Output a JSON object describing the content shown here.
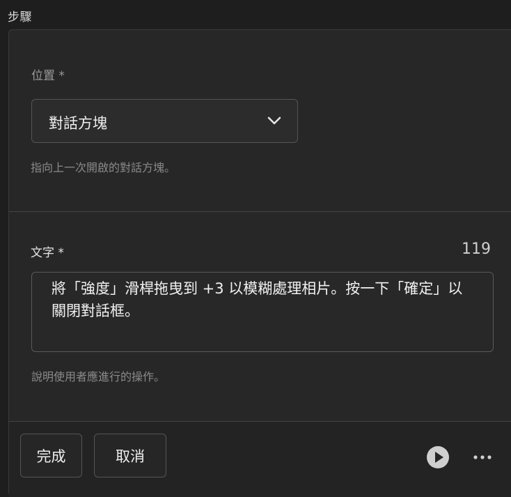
{
  "section": {
    "title": "步驟"
  },
  "location": {
    "label": "位置 *",
    "selected": "對話方塊",
    "helper": "指向上一次開啟的對話方塊。"
  },
  "text_field": {
    "label": "文字 *",
    "remaining": "119",
    "value": "將「強度」滑桿拖曳到 +3 以模糊處理相片。按一下「確定」以關閉對話框。",
    "helper": "說明使用者應進行的操作。"
  },
  "footer": {
    "done_label": "完成",
    "cancel_label": "取消"
  },
  "icons": {
    "dropdown": "chevron-down-icon",
    "play": "play-icon",
    "more": "more-horizontal-icon"
  }
}
